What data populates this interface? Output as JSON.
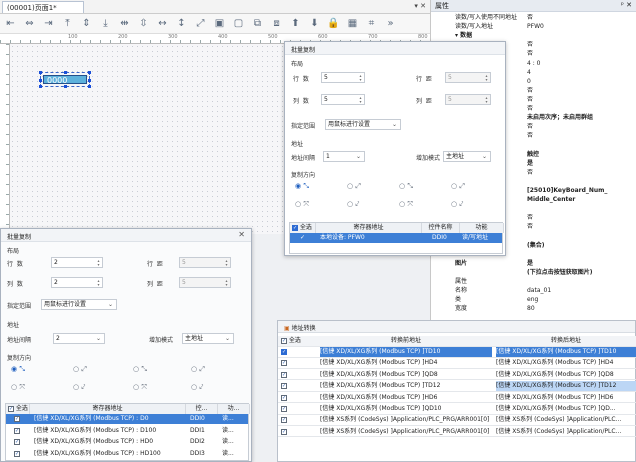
{
  "editor": {
    "tab_label": "(00001)页面1*",
    "tab_controls": "▾ ✕",
    "ruler_marks": [
      "100",
      "200",
      "300",
      "400",
      "500",
      "600",
      "700",
      "800"
    ],
    "keyboard_value": "0000"
  },
  "toolbar_icons": [
    "align-left-icon",
    "align-center-icon",
    "align-right-icon",
    "align-top-icon",
    "align-middle-icon",
    "align-bottom-icon",
    "distribute-h-icon",
    "distribute-v-icon",
    "same-width-icon",
    "same-height-icon",
    "same-size-icon",
    "group-icon",
    "ungroup-icon",
    "bring-front-icon",
    "send-back-icon",
    "layer-up-icon",
    "layer-down-icon",
    "lock-icon",
    "grid-icon",
    "snap-icon",
    "more-icon"
  ],
  "properties": {
    "title": "属性",
    "controls": "ᵖ ✕",
    "rows": [
      {
        "k": "读数/写入使用不同地址",
        "v": "否"
      },
      {
        "k": "读数/写入地址",
        "v": "PFW0"
      },
      {
        "k": "▾ 数据",
        "v": "",
        "bold": true
      },
      {
        "k": "",
        "v": "否"
      },
      {
        "k": "",
        "v": "否"
      },
      {
        "k": "式",
        "v": "4 : 0"
      },
      {
        "k": "位数",
        "v": "4"
      },
      {
        "k": "位数",
        "v": "0"
      },
      {
        "k": "输入上限",
        "v": "否"
      },
      {
        "k": "输入下限",
        "v": "否"
      },
      {
        "k": "示样式",
        "v": "否"
      },
      {
        "k": "",
        "v": "未启用次序；未启用群组",
        "bold": true
      },
      {
        "k": "入次序",
        "v": "否"
      },
      {
        "k": "完成后不再提",
        "v": "否"
      },
      {
        "k": "",
        "v": ""
      },
      {
        "k": "方式",
        "v": "触控",
        "bold": true
      },
      {
        "k": "弹出键盘",
        "v": "是",
        "bold": true
      },
      {
        "k": "上下限值",
        "v": "否"
      },
      {
        "k": "键盘",
        "v": ""
      },
      {
        "k": "键盘编号",
        "v": "[25010]KeyBoard_Num_",
        "bold": true
      },
      {
        "k": "弹出位置",
        "v": "Middle_Center",
        "bold": true
      },
      {
        "k": "换",
        "v": "",
        "bold": true
      },
      {
        "k": "转换",
        "v": "否"
      },
      {
        "k": "转换",
        "v": "否"
      },
      {
        "k": "",
        "v": ""
      },
      {
        "k": "",
        "v": "(集合)",
        "bold": true
      },
      {
        "k": "",
        "v": ""
      },
      {
        "k": "图片",
        "v": "是",
        "bold": true
      },
      {
        "k": "",
        "v": "(下拉点击按钮获取图片)",
        "bold": true
      },
      {
        "k": "属性",
        "v": ""
      },
      {
        "k": "名称",
        "v": "data_01"
      },
      {
        "k": "类",
        "v": "eng"
      },
      {
        "k": "宽度",
        "v": "80"
      }
    ]
  },
  "dialog_front": {
    "title": "批量复制",
    "close": "✕",
    "layout_label": "布局",
    "rows_label": "行  数",
    "rows_value": "5",
    "row_gap_label": "行  距",
    "row_gap_value": "5",
    "cols_label": "列  数",
    "cols_value": "5",
    "col_gap_label": "列  距",
    "col_gap_value": "5",
    "range_label": "指定范围",
    "range_value": "用鼠标进行设置",
    "address_label": "地址",
    "interval_label": "地址间隔",
    "interval_value": "1",
    "mode_label": "增加模式",
    "mode_value": "主地址",
    "direction_label": "复制方向",
    "table_headers": [
      "全选",
      "寄存器地址",
      "控件名称",
      "功能"
    ],
    "table_rows": [
      {
        "addr": "本地设备: PFW0",
        "name": "DDI0",
        "func": "读/写地址"
      }
    ]
  },
  "dialog_back": {
    "title": "批量复制",
    "close": "✕",
    "layout_label": "布局",
    "rows_label": "行  数",
    "rows_value": "2",
    "row_gap_label": "行  距",
    "row_gap_value": "5",
    "cols_label": "列  数",
    "cols_value": "2",
    "col_gap_label": "列  距",
    "col_gap_value": "5",
    "range_label": "指定范围",
    "range_value": "用鼠标进行设置",
    "address_label": "地址",
    "interval_label": "地址间隔",
    "interval_value": "2",
    "mode_label": "增加模式",
    "mode_value": "主地址",
    "direction_label": "复制方向",
    "table_headers": [
      "全选",
      "寄存器地址",
      "控...",
      "功..."
    ],
    "table_rows": [
      {
        "addr": "[信捷 XD/XL/XG系列 (Modbus TCP) : D0",
        "name": "DDI0",
        "func": "读..."
      },
      {
        "addr": "[信捷 XD/XL/XG系列 (Modbus TCP) : D100",
        "name": "DDI1",
        "func": "读..."
      },
      {
        "addr": "[信捷 XD/XL/XG系列 (Modbus TCP) : HD0",
        "name": "DDI2",
        "func": "读..."
      },
      {
        "addr": "[信捷 XD/XL/XG系列 (Modbus TCP) : HD100",
        "name": "DDI3",
        "func": "读..."
      }
    ]
  },
  "conversion": {
    "title": "地址转换",
    "headers": [
      "全选",
      "转换前地址",
      "转换后地址"
    ],
    "rows": [
      {
        "before": "[信捷 XD/XL/XG系列 (Modbus TCP) ]TD10",
        "after": "[信捷 XD/XL/XG系列 (Modbus TCP) ]TD10"
      },
      {
        "before": "[信捷 XD/XL/XG系列 (Modbus TCP) ]HD4",
        "after": "[信捷 XD/XL/XG系列 (Modbus TCP) ]HD4"
      },
      {
        "before": "[信捷 XD/XL/XG系列 (Modbus TCP) ]QD8",
        "after": "[信捷 XD/XL/XG系列 (Modbus TCP) ]QD8"
      },
      {
        "before": "[信捷 XD/XL/XG系列 (Modbus TCP) ]TD12",
        "after": "[信捷 XD/XL/XG系列 (Modbus TCP) ]TD12"
      },
      {
        "before": "[信捷 XD/XL/XG系列 (Modbus TCP) ]HD6",
        "after": "[信捷 XD/XL/XG系列 (Modbus TCP) ]HD6"
      },
      {
        "before": "[信捷 XD/XL/XG系列 (Modbus TCP) ]QD10",
        "after": "[信捷 XD/XL/XG系列 (Modbus TCP) ]QD..."
      },
      {
        "before": "[信捷 XS系列 (CodeSys) ]Application/PLC_PRG/ARR001[0]",
        "after": "[信捷 XS系列 (CodeSys) ]Application/PLC..."
      },
      {
        "before": "[信捷 XS系列 (CodeSys) ]Application/PLC_PRG/ARR001[0]",
        "after": "[信捷 XS系列 (CodeSys) ]Application/PLC..."
      }
    ]
  }
}
